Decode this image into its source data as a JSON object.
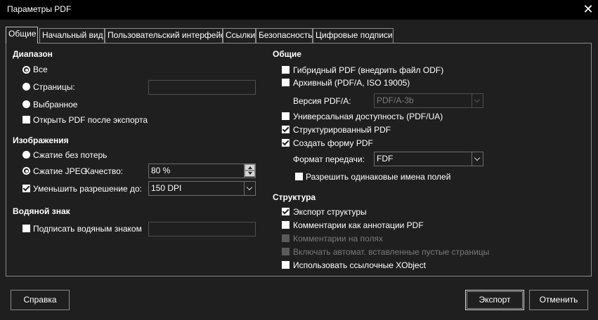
{
  "window": {
    "title": "Параметры PDF",
    "close": "✕"
  },
  "tabs": [
    "Общие",
    "Начальный вид",
    "Пользовательский интерфейс",
    "Ссылки",
    "Безопасность",
    "Цифровые подписи"
  ],
  "range": {
    "heading": "Диапазон",
    "all": "Все",
    "pages": "Страницы:",
    "selection": "Выбранное",
    "open_after": "Открыть PDF после экспорта"
  },
  "images": {
    "heading": "Изображения",
    "lossless": "Сжатие без потерь",
    "jpeg": "Сжатие JPEG",
    "quality_label": "Качество:",
    "quality_value": "80 %",
    "reduce": "Уменьшить разрешение до:",
    "dpi_value": "150 DPI"
  },
  "watermark": {
    "heading": "Водяной знак",
    "sign": "Подписать водяным знаком"
  },
  "general": {
    "heading": "Общие",
    "hybrid": "Гибридный PDF (внедрить файл ODF)",
    "archive": "Архивный (PDF/A, ISO 19005)",
    "pdfa_label": "Версия PDF/A:",
    "pdfa_value": "PDF/A-3b",
    "ua": "Универсальная доступность (PDF/UA)",
    "tagged": "Структурированный PDF",
    "form": "Создать форму PDF",
    "submit_label": "Формат передачи:",
    "submit_value": "FDF",
    "duplicate": "Разрешить одинаковые имена полей"
  },
  "structure": {
    "heading": "Структура",
    "export_outline": "Экспорт структуры",
    "comments_annot": "Комментарии как аннотации PDF",
    "comments_margin": "Комментарии на полях",
    "blank_pages": "Включать автомат. вставленные пустые страницы",
    "xobject": "Использовать ссылочные XObject"
  },
  "buttons": {
    "help": "Справка",
    "export": "Экспорт",
    "cancel": "Отменить"
  }
}
